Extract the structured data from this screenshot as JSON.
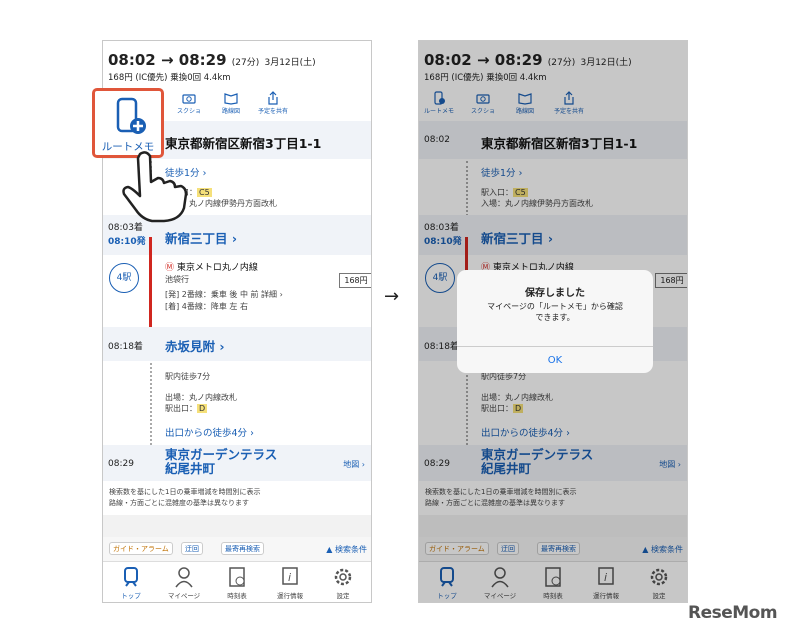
{
  "header": {
    "time_range": "08:02 → 08:29",
    "duration": "(27分)",
    "date": "3月12日(土)",
    "fare_line": "168円 (IC優先) 乗換0回 4.4km"
  },
  "toolbar": [
    {
      "label": "ルートメモ",
      "icon": "phone-plus-icon"
    },
    {
      "label": "スクショ",
      "icon": "camera-icon"
    },
    {
      "label": "路線図",
      "icon": "map-book-icon"
    },
    {
      "label": "予定を共有",
      "icon": "share-icon"
    }
  ],
  "route": {
    "start_time": "08:02",
    "start_name": "東京都新宿区新宿3丁目1-1",
    "walk1": "徒歩1分 ›",
    "entrance_label": "駅入口：",
    "entrance_code": "C5",
    "entry_gate": "入場：丸ノ内線伊勢丹方面改札",
    "station1_arr": "08:03着",
    "station1_dep": "08:10発",
    "station1_name": "新宿三丁目 ›",
    "line_name": "東京メトロ丸ノ内線",
    "line_dir": "池袋行",
    "board_info": "[発] 2番線：乗車 後 中 前 詳細 ›",
    "alight_info": "[着] 4番線：降車 左 右",
    "stations_badge": "4駅",
    "fare": "168円",
    "station2_arr": "08:18着",
    "station2_name": "赤坂見附 ›",
    "transfer_walk": "駅内徒歩7分",
    "exit_gate": "出場：丸ノ内線改札",
    "exit_label": "駅出口：",
    "exit_code": "D",
    "walk2": "出口からの徒歩4分 ›",
    "end_time": "08:29",
    "end_name_1": "東京ガーデンテラス",
    "end_name_2": "紀尾井町",
    "map_link": "地図 ›"
  },
  "info_note_1": "検索数を基にした1日の乗車増減を時間別に表示",
  "info_note_2": "路線・方面ごとに混雑度の基準は異なります",
  "actions": {
    "guide": "ガイド・アラーム",
    "detour": "迂回",
    "nearest": "最寄再検索",
    "conditions": "▲ 検索条件"
  },
  "tabs": [
    {
      "label": "トップ",
      "icon": "train-icon"
    },
    {
      "label": "マイページ",
      "icon": "person-icon"
    },
    {
      "label": "時刻表",
      "icon": "timetable-icon"
    },
    {
      "label": "運行情報",
      "icon": "info-icon"
    },
    {
      "label": "設定",
      "icon": "gear-icon"
    }
  ],
  "callout_label": "ルートメモ",
  "dialog": {
    "title": "保存しました",
    "message": "マイページの「ルートメモ」から確認\nできます。",
    "ok": "OK"
  },
  "transition_arrow": "→",
  "watermark": "ReseMom"
}
